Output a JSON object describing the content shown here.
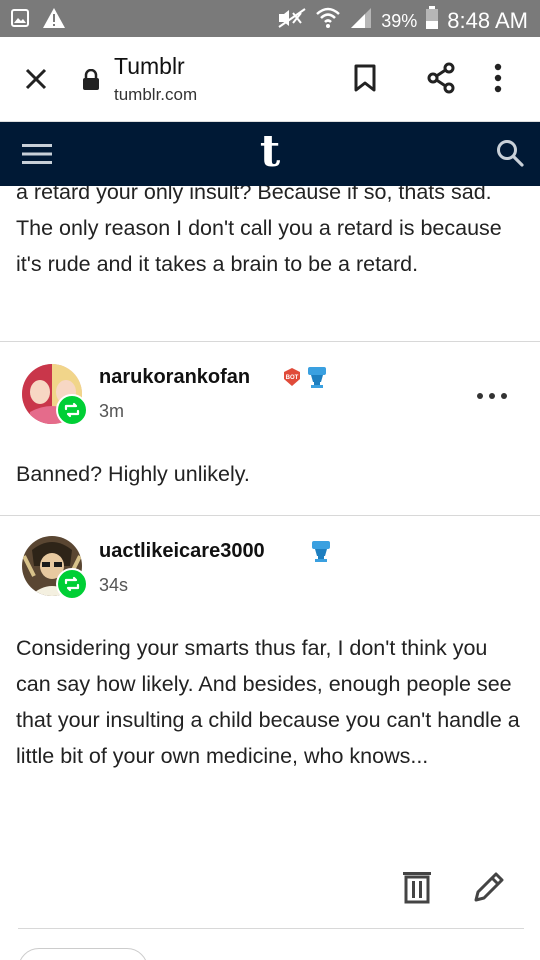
{
  "status_bar": {
    "battery": "39%",
    "time": "8:48 AM",
    "icons": [
      "image-icon",
      "warning-icon",
      "mute-icon",
      "wifi-icon",
      "signal-icon",
      "battery-icon"
    ]
  },
  "browser": {
    "title": "Tumblr",
    "url": "tumblr.com",
    "icons": [
      "close-icon",
      "lock-icon",
      "bookmark-icon",
      "share-icon",
      "more-vertical-icon"
    ]
  },
  "tumblr_header": {
    "logo": "t",
    "icons": [
      "menu-icon",
      "search-icon"
    ]
  },
  "posts": [
    {
      "text": "a retard your only insult? Because if so, thats sad. The only reason I don't call you a retard is because it's rude and it takes a brain to be a retard."
    },
    {
      "username": "narukorankofan",
      "time": "3m",
      "text": "Banned? Highly unlikely.",
      "badges": [
        "bot-badge-icon",
        "trophy-badge-icon"
      ]
    },
    {
      "username": "uactlikeicare3000",
      "time": "34s",
      "text": "Considering your smarts thus far, I don't think you can say how likely. And besides, enough people see that your insulting a child because you can't handle a little bit of your own medicine, who knows...",
      "badges": [
        "trophy-badge-icon"
      ]
    }
  ],
  "actions": [
    "delete-icon",
    "edit-icon"
  ],
  "colors": {
    "status_bar": "#7a7a7a",
    "tumblr_navy": "#001935",
    "reblog_green": "#00cf35"
  }
}
